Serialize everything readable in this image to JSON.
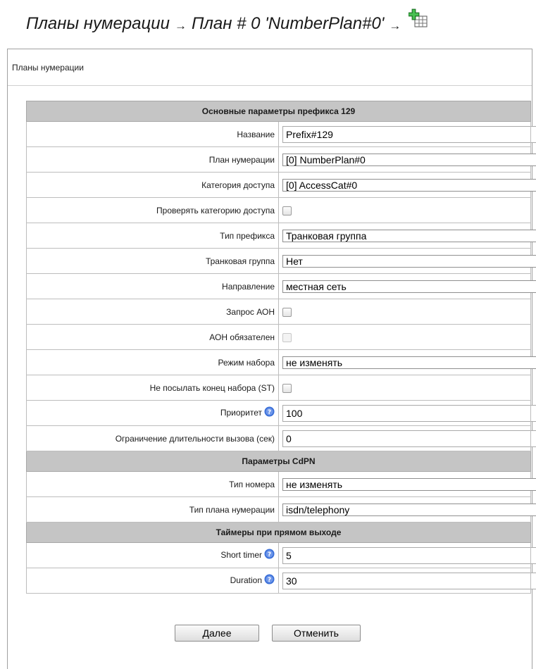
{
  "breadcrumb": {
    "part1": "Планы нумерации",
    "part2": "План # 0 'NumberPlan#0'",
    "arrow": "→",
    "add_icon": "add-table-icon"
  },
  "panel": {
    "title": "Планы нумерации"
  },
  "section_main": {
    "title": "Основные параметры префикса 129",
    "name": {
      "label": "Название",
      "value": "Prefix#129"
    },
    "number_plan": {
      "label": "План нумерации",
      "value": "[0] NumberPlan#0"
    },
    "access_category": {
      "label": "Категория доступа",
      "value": "[0] AccessCat#0"
    },
    "check_access_category": {
      "label": "Проверять категорию доступа",
      "checked": false
    },
    "prefix_type": {
      "label": "Тип префикса",
      "value": "Транковая группа"
    },
    "trunk_group": {
      "label": "Транковая группа",
      "value": "Нет"
    },
    "direction": {
      "label": "Направление",
      "value": "местная сеть"
    },
    "aon_request": {
      "label": "Запрос АОН",
      "checked": false
    },
    "aon_required": {
      "label": "АОН обязателен",
      "checked": false,
      "disabled": true
    },
    "dial_mode": {
      "label": "Режим набора",
      "value": "не изменять"
    },
    "no_end_dial": {
      "label": "Не посылать конец набора (ST)",
      "checked": false
    },
    "priority": {
      "label": "Приоритет",
      "value": "100"
    },
    "call_limit": {
      "label": "Ограничение длительности вызова (сек)",
      "value": "0"
    }
  },
  "section_cdpn": {
    "title": "Параметры CdPN",
    "number_type": {
      "label": "Тип номера",
      "value": "не изменять"
    },
    "numbering_plan_type": {
      "label": "Тип плана нумерации",
      "value": "isdn/telephony"
    }
  },
  "section_timers": {
    "title": "Таймеры при прямом выходе",
    "short_timer": {
      "label": "Short timer",
      "value": "5"
    },
    "duration": {
      "label": "Duration",
      "value": "30"
    }
  },
  "buttons": {
    "next": "Далее",
    "cancel": "Отменить"
  },
  "colors": {
    "section_bg": "#c5c5c5",
    "help_icon": "#3a6fd8"
  },
  "select_caret": "▼"
}
